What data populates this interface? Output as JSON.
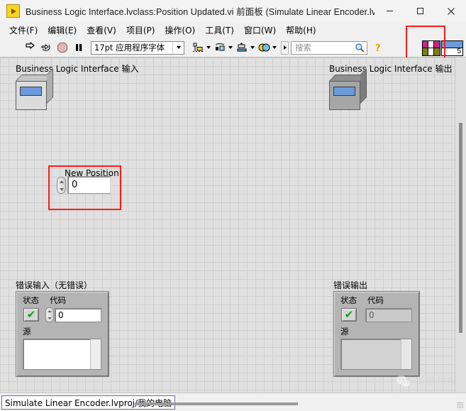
{
  "window": {
    "title": "Business Logic Interface.lvclass:Position Updated.vi 前面板  (Simulate Linear Encoder.lvproj...",
    "app_icon": "labview-vi-icon",
    "minimize": "—",
    "maximize": "□",
    "close": "✕"
  },
  "menubar": {
    "items": [
      {
        "label": "文件(F)"
      },
      {
        "label": "编辑(E)"
      },
      {
        "label": "查看(V)"
      },
      {
        "label": "项目(P)"
      },
      {
        "label": "操作(O)"
      },
      {
        "label": "工具(T)"
      },
      {
        "label": "窗口(W)"
      },
      {
        "label": "帮助(H)"
      }
    ]
  },
  "toolbar": {
    "run": "run-arrow-icon",
    "run_continuously": "run-continuously-icon",
    "abort": "abort-execution-icon",
    "pause": "pause-icon",
    "font_selector": "17pt 应用程序字体",
    "align_objects": "align-objects-icon",
    "distribute_objects": "distribute-objects-icon",
    "resize_objects": "resize-objects-icon",
    "reorder_objects": "reorder-objects-icon",
    "search_placeholder": "搜索",
    "search_value": "",
    "search_icon": "magnifier-icon",
    "help_icon": "context-help-icon",
    "vi_icon_number": "5"
  },
  "panel": {
    "input_control": {
      "label": "Business Logic Interface 输入",
      "type": "class-refnum-control"
    },
    "output_indicator": {
      "label": "Business Logic Interface 输出",
      "type": "class-refnum-indicator"
    },
    "new_position": {
      "label": "New Position",
      "value": "0"
    },
    "error_in": {
      "label": "错误输入（无错误）",
      "status_label": "状态",
      "status_value": "✔",
      "code_label": "代码",
      "code_value": "0",
      "source_label": "源",
      "source_value": ""
    },
    "error_out": {
      "label": "错误输出",
      "status_label": "状态",
      "status_value": "✔",
      "code_label": "代码",
      "code_value": "0",
      "source_label": "源",
      "source_value": ""
    }
  },
  "statusbar": {
    "text": "Simulate Linear Encoder.lvproj/我的电脑"
  },
  "watermark": {
    "text": "华穗科技",
    "icon": "wechat-icon"
  },
  "colors": {
    "canvas": "#e0e0e0",
    "grid": "#cfcfcf",
    "highlight": "#ff1a1a",
    "refnum_blue": "#6b9bdb",
    "ok_green": "#12a012",
    "cluster_gray": "#b4b4b4"
  }
}
